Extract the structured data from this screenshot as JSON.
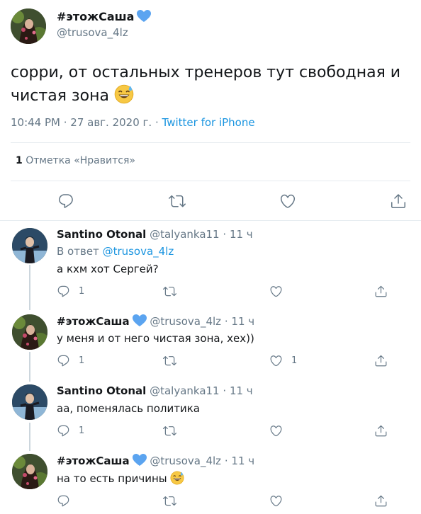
{
  "colors": {
    "text": "#14171a",
    "secondary": "#657786",
    "link": "#1b95e0",
    "divider": "#e6ecf0",
    "badge_heart": "#5ba4f0"
  },
  "main_tweet": {
    "author_name": "#этожСаша",
    "author_badge": "blue-heart-emoji",
    "author_handle": "@trusova_4lz",
    "text": "сорри, от остальных тренеров тут свободная и чистая зона",
    "text_emoji": "grinning-sweat-emoji",
    "time": "10:44 PM · 27 авг. 2020 г.",
    "separator": "·",
    "source": "Twitter for iPhone",
    "likes_count": "1",
    "likes_label": "Отметка «Нравится»",
    "actions": [
      "reply-icon",
      "retweet-icon",
      "like-icon",
      "share-icon"
    ]
  },
  "replies": [
    {
      "author_name": "Santino Otonal",
      "author_handle": "@talyanka11",
      "dot": "·",
      "time": "11 ч",
      "in_reply_label": "В ответ",
      "in_reply_mention": "@trusova_4lz",
      "text": "а кхм хот Сергей?",
      "reply_count": "1",
      "like_count": ""
    },
    {
      "author_name": "#этожСаша",
      "author_handle": "@trusova_4lz",
      "dot": "·",
      "time": "11 ч",
      "text": "у меня и от него чистая зона, хех))",
      "reply_count": "1",
      "like_count": "1"
    },
    {
      "author_name": "Santino Otonal",
      "author_handle": "@talyanka11",
      "dot": "·",
      "time": "11 ч",
      "text": "аа, поменялась политика",
      "reply_count": "1",
      "like_count": ""
    },
    {
      "author_name": "#этожСаша",
      "author_handle": "@trusova_4lz",
      "dot": "·",
      "time": "11 ч",
      "text": "на то есть причины",
      "text_emoji": "grinning-sweat-emoji",
      "reply_count": "",
      "like_count": ""
    }
  ]
}
